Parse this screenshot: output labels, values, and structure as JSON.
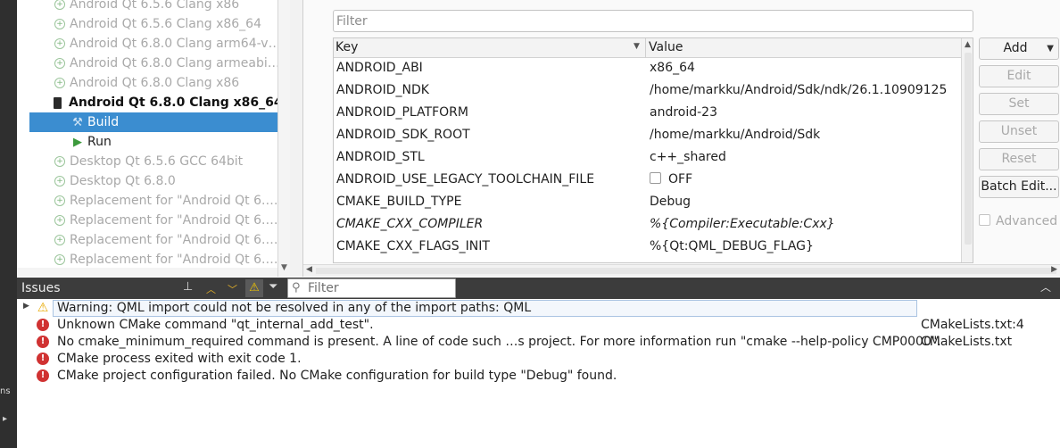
{
  "left_strip": {
    "fragment": "ns",
    "arrow": "▸"
  },
  "kits": [
    {
      "label": "Android Qt 6.5.6 Clang x86",
      "state": "disabled",
      "kind": "kit"
    },
    {
      "label": "Android Qt 6.5.6 Clang x86_64",
      "state": "disabled",
      "kind": "kit"
    },
    {
      "label": "Android Qt 6.8.0 Clang arm64-v…",
      "state": "disabled",
      "kind": "kit"
    },
    {
      "label": "Android Qt 6.8.0 Clang armeabi…",
      "state": "disabled",
      "kind": "kit"
    },
    {
      "label": "Android Qt 6.8.0 Clang x86",
      "state": "disabled",
      "kind": "kit"
    },
    {
      "label": "Android Qt 6.8.0 Clang x86_64",
      "state": "active",
      "kind": "kit"
    },
    {
      "label": "Build",
      "state": "selected",
      "kind": "build"
    },
    {
      "label": "Run",
      "state": "normal",
      "kind": "run"
    },
    {
      "label": "Desktop Qt 6.5.6 GCC 64bit",
      "state": "disabled",
      "kind": "kit"
    },
    {
      "label": "Desktop Qt 6.8.0",
      "state": "disabled",
      "kind": "kit"
    },
    {
      "label": "Replacement for \"Android Qt 6.…",
      "state": "disabled",
      "kind": "kit"
    },
    {
      "label": "Replacement for \"Android Qt 6.…",
      "state": "disabled",
      "kind": "kit"
    },
    {
      "label": "Replacement for \"Android Qt 6.…",
      "state": "disabled",
      "kind": "kit"
    },
    {
      "label": "Replacement for \"Android Qt 6.…",
      "state": "disabled",
      "kind": "kit"
    }
  ],
  "config": {
    "filter_placeholder": "Filter",
    "header": {
      "key": "Key",
      "value": "Value"
    },
    "rows": [
      {
        "key": "ANDROID_ABI",
        "value": "x86_64",
        "italic": false,
        "checkbox": false
      },
      {
        "key": "ANDROID_NDK",
        "value": "/home/markku/Android/Sdk/ndk/26.1.10909125",
        "italic": false,
        "checkbox": false
      },
      {
        "key": "ANDROID_PLATFORM",
        "value": "android-23",
        "italic": false,
        "checkbox": false
      },
      {
        "key": "ANDROID_SDK_ROOT",
        "value": "/home/markku/Android/Sdk",
        "italic": false,
        "checkbox": false
      },
      {
        "key": "ANDROID_STL",
        "value": "c++_shared",
        "italic": false,
        "checkbox": false
      },
      {
        "key": "ANDROID_USE_LEGACY_TOOLCHAIN_FILE",
        "value": "OFF",
        "italic": false,
        "checkbox": true
      },
      {
        "key": "CMAKE_BUILD_TYPE",
        "value": "Debug",
        "italic": false,
        "checkbox": false
      },
      {
        "key": "CMAKE_CXX_COMPILER",
        "value": "%{Compiler:Executable:Cxx}",
        "italic": true,
        "checkbox": false
      },
      {
        "key": "CMAKE_CXX_FLAGS_INIT",
        "value": "%{Qt:QML_DEBUG_FLAG}",
        "italic": false,
        "checkbox": false
      }
    ],
    "buttons": {
      "add": "Add",
      "edit": "Edit",
      "set": "Set",
      "unset": "Unset",
      "reset": "Reset",
      "batch_edit": "Batch Edit..."
    },
    "advanced_label": "Advanced"
  },
  "issues": {
    "title": "Issues",
    "filter_placeholder": "Filter",
    "items": [
      {
        "severity": "warning",
        "message": "Warning: QML import could not be resolved in any of the import paths: QML",
        "location": "",
        "expandable": true,
        "highlighted": true
      },
      {
        "severity": "error",
        "message": "Unknown CMake command \"qt_internal_add_test\".",
        "location": "CMakeLists.txt:4",
        "expandable": false,
        "highlighted": false
      },
      {
        "severity": "error",
        "message": "No cmake_minimum_required command is present.  A line of code such …s project.  For more information run \"cmake --help-policy CMP0000\".",
        "location": "CMakeLists.txt",
        "expandable": false,
        "highlighted": false
      },
      {
        "severity": "error",
        "message": "CMake process exited with exit code 1.",
        "location": "",
        "expandable": false,
        "highlighted": false
      },
      {
        "severity": "error",
        "message": "CMake project configuration failed. No CMake configuration for build type \"Debug\" found.",
        "location": "",
        "expandable": false,
        "highlighted": false
      }
    ]
  },
  "colors": {
    "selection": "#3b8dd0",
    "issues_bar": "#3c3c3c",
    "error": "#d03232",
    "warning": "#e8a900"
  }
}
